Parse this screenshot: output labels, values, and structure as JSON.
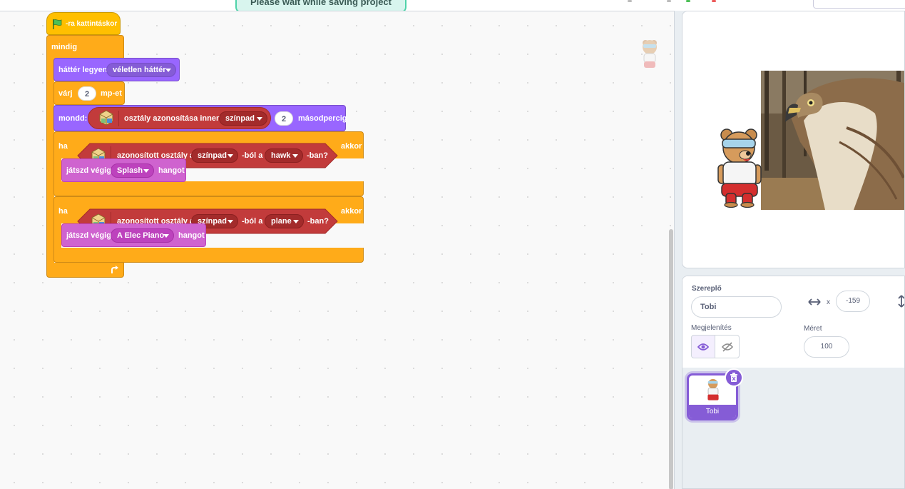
{
  "top": {
    "toast": "Please wait while saving project"
  },
  "script": {
    "event_label": "-ra kattintáskor",
    "forever_label": "mindig",
    "switch_backdrop": {
      "label": "háttér legyen",
      "menu": "véletlen háttér"
    },
    "wait": {
      "label": "várj",
      "value": "2",
      "unit": "mp-et"
    },
    "say": {
      "label": "mondd:",
      "classify_label": "osztály azonosítása innen:",
      "source": "színpad",
      "value": "2",
      "unit": "másodpercig"
    },
    "if1": {
      "label": "ha",
      "cond_label": "azonosított osztály a",
      "source": "színpad",
      "mid": "-ból a",
      "cls": "hawk",
      "end": "-ban?",
      "then": "akkor"
    },
    "play1": {
      "label": "játszd végig",
      "sound": "Splash",
      "suffix": "hangot"
    },
    "if2": {
      "label": "ha",
      "cond_label": "azonosított osztály a",
      "source": "színpad",
      "mid": "-ból a",
      "cls": "plane",
      "end": "-ban?",
      "then": "akkor"
    },
    "play2": {
      "label": "játszd végig",
      "sound": "A Elec Piano",
      "suffix": "hangot"
    }
  },
  "sprite_info": {
    "sprite_label": "Szereplő",
    "sprite_name": "Tobi",
    "x_label": "x",
    "x_value": "-159",
    "show_label": "Megjelenítés",
    "size_label": "Méret",
    "size_value": "100"
  },
  "sprite_tray": {
    "items": [
      {
        "name": "Tobi"
      }
    ]
  },
  "colors": {
    "events": "#ffbf00",
    "control": "#ffab19",
    "looks": "#9966ff",
    "sound": "#cf63cf",
    "ml": "#c23b3b",
    "accent": "#855cd6"
  },
  "icons": [
    "green-flag-icon",
    "ml-extension-icon",
    "loop-arrow-icon",
    "arrows-horizontal-icon",
    "arrows-vertical-icon",
    "eye-icon",
    "eye-slash-icon",
    "trash-icon"
  ]
}
